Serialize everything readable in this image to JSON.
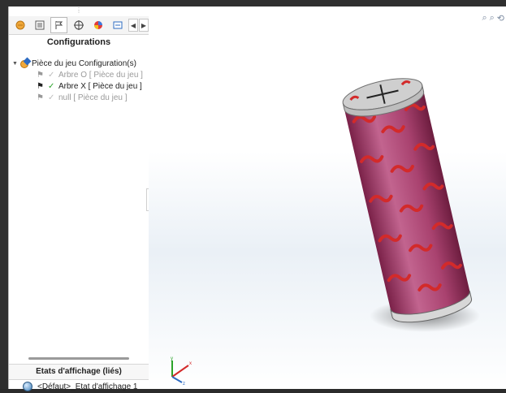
{
  "panel": {
    "title": "Configurations",
    "tabs": [
      {
        "name": "feature-manager-tab",
        "icon": "feature-manager-icon"
      },
      {
        "name": "property-manager-tab",
        "icon": "property-manager-icon"
      },
      {
        "name": "configuration-manager-tab",
        "icon": "configuration-manager-icon"
      },
      {
        "name": "dimxpert-tab",
        "icon": "dimxpert-icon"
      },
      {
        "name": "display-manager-tab",
        "icon": "display-manager-icon"
      },
      {
        "name": "more-tab",
        "icon": "more-icon"
      }
    ]
  },
  "tree": {
    "root_label": "Pièce du jeu Configuration(s)",
    "configs": [
      {
        "label": "Arbre O [ Pièce du jeu ]",
        "active": false
      },
      {
        "label": "Arbre X [ Pièce du jeu ]",
        "active": true
      },
      {
        "label": "null [ Pièce du jeu ]",
        "active": false
      }
    ]
  },
  "display_states": {
    "header": "Etats d'affichage (liés)",
    "item": "<Défaut>_Etat d'affichage 1"
  },
  "colors": {
    "cylinder_body": "#b34a7a",
    "pattern": "#d32a2a",
    "cap": "#c9c9c9",
    "check_active": "#2aa32a"
  }
}
